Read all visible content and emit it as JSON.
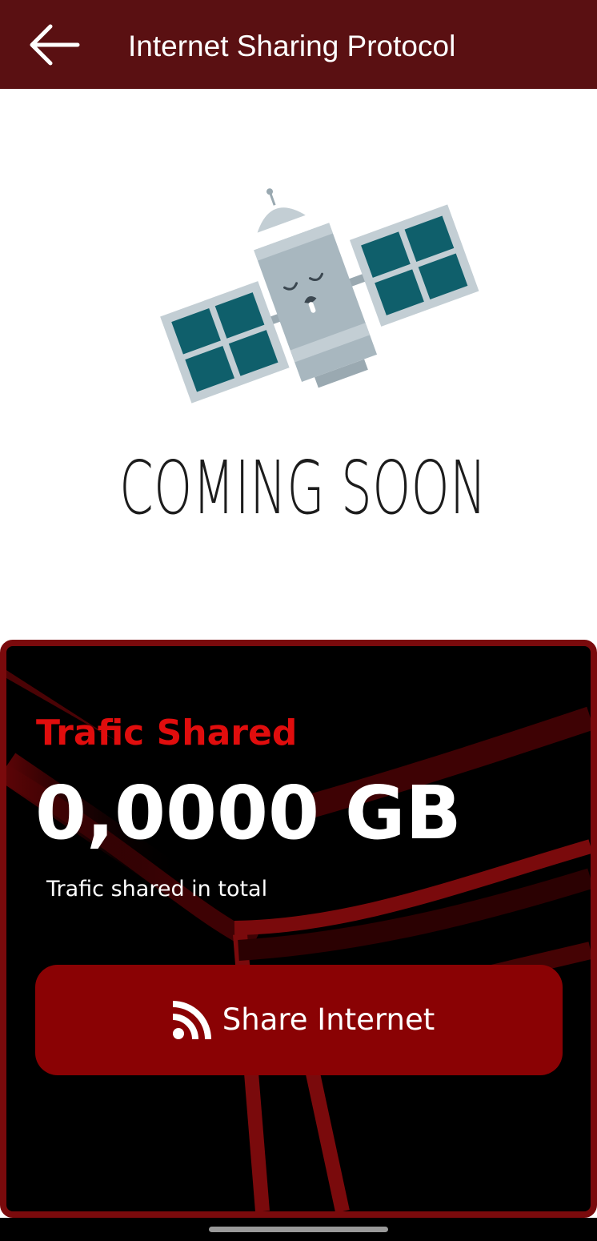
{
  "header": {
    "title": "Internet Sharing Protocol",
    "back_icon": "arrow-left-icon",
    "background": "#5a1012"
  },
  "illustration": {
    "icon": "sleeping-satellite-illustration",
    "caption": "COMING SOON"
  },
  "traffic_card": {
    "label": "Trafic Shared",
    "value": "0,0000 GB",
    "caption": "Trafic shared in total",
    "button": {
      "label": "Share Internet",
      "icon": "rss-feed-icon"
    },
    "colors": {
      "border": "#7a0a0c",
      "label": "#e00d0d",
      "button": "#8a0204"
    }
  }
}
